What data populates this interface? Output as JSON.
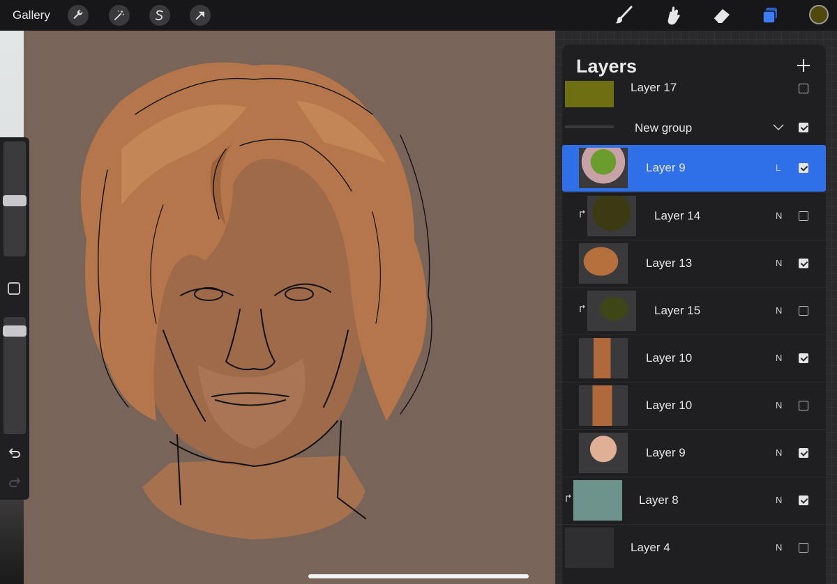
{
  "topbar": {
    "gallery_label": "Gallery",
    "left_tools": [
      "wrench-icon",
      "magic-wand-icon",
      "selection-icon",
      "transform-arrow-icon"
    ],
    "right_tools": [
      "brush-icon",
      "smudge-icon",
      "eraser-icon",
      "layers-icon"
    ],
    "current_color": "#4f4a0c",
    "active_accent": "#3d7cf2"
  },
  "layers": {
    "title": "Layers",
    "top_partial": {
      "name": "Layer 17",
      "thumb_color": "#6e6e12"
    },
    "group": {
      "name": "New group",
      "checked": true
    },
    "items": [
      {
        "name": "Layer 9",
        "blend": "L",
        "checked": true,
        "selected": true,
        "clipped": false
      },
      {
        "name": "Layer 14",
        "blend": "N",
        "checked": false,
        "selected": false,
        "clipped": true
      },
      {
        "name": "Layer 13",
        "blend": "N",
        "checked": true,
        "selected": false,
        "clipped": false
      },
      {
        "name": "Layer 15",
        "blend": "N",
        "checked": false,
        "selected": false,
        "clipped": true
      },
      {
        "name": "Layer 10",
        "blend": "N",
        "checked": true,
        "selected": false,
        "clipped": false
      },
      {
        "name": "Layer 10",
        "blend": "N",
        "checked": false,
        "selected": false,
        "clipped": false
      },
      {
        "name": "Layer 9",
        "blend": "N",
        "checked": true,
        "selected": false,
        "clipped": false
      },
      {
        "name": "Layer 8",
        "blend": "N",
        "checked": true,
        "selected": false,
        "clipped": true
      },
      {
        "name": "Layer 4",
        "blend": "N",
        "checked": false,
        "selected": false,
        "clipped": false
      }
    ]
  },
  "sidebar": {
    "brush_size_level": 0.48,
    "opacity_level": 0.92
  }
}
